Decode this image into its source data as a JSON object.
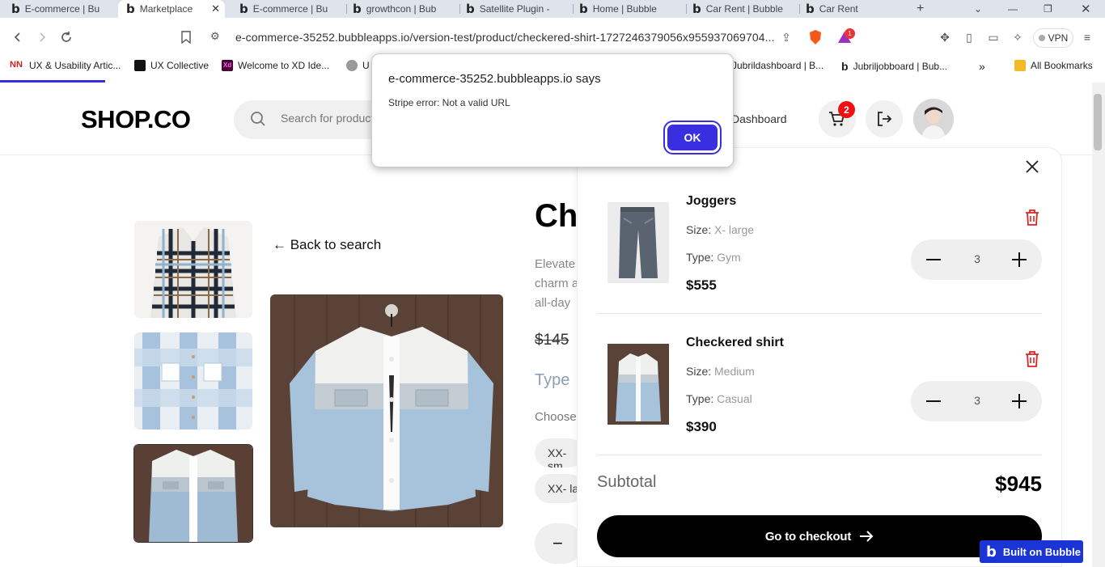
{
  "browser": {
    "tabs": [
      {
        "label": "E-commerce | Bu"
      },
      {
        "label": "Marketplace"
      },
      {
        "label": "E-commerce | Bu"
      },
      {
        "label": "growthcon | Bub"
      },
      {
        "label": "Satellite Plugin -"
      },
      {
        "label": "Home | Bubble"
      },
      {
        "label": "Car Rent | Bubble"
      },
      {
        "label": "Car Rent"
      }
    ],
    "new_tab": "+",
    "url": "e-commerce-35252.bubbleapps.io/version-test/product/checkered-shirt-1727246379056x955937069704...",
    "vpn_label": "VPN",
    "brave_rewards_count": "1",
    "bookmarks": [
      {
        "label": "UX & Usability Artic...",
        "color": "#c22"
      },
      {
        "label": "UX Collective",
        "color": "#111"
      },
      {
        "label": "Welcome to XD Ide...",
        "color": "#470137"
      },
      {
        "label": "U",
        "color": "#666"
      },
      {
        "label": "Jubrildashboard | B...",
        "color": "#222"
      },
      {
        "label": "Jubriljobboard | Bub...",
        "color": "#222"
      }
    ],
    "more_bookmarks": "»",
    "all_bookmarks": "All Bookmarks"
  },
  "header": {
    "logo": "SHOP.CO",
    "search_placeholder": "Search for products...",
    "dashboard_link": "Dashboard",
    "cart_count": "2"
  },
  "product": {
    "back_label": "← Back to search",
    "title": "Ch",
    "desc_lines": [
      "Elevate",
      "charm a",
      "all-day"
    ],
    "old_price": "$145",
    "type_label": "Type",
    "choose_label": "Choose",
    "size_chips": [
      "XX- sm",
      "XX- la"
    ],
    "qty_minus": "−"
  },
  "cart": {
    "items": [
      {
        "name": "Joggers",
        "size_label": "Size:",
        "size": "X- large",
        "type_label": "Type:",
        "type": "Gym",
        "price": "$555",
        "qty": "3"
      },
      {
        "name": "Checkered shirt",
        "size_label": "Size:",
        "size": "Medium",
        "type_label": "Type:",
        "type": "Casual",
        "price": "$390",
        "qty": "3"
      }
    ],
    "subtotal_label": "Subtotal",
    "subtotal_value": "$945",
    "checkout_label": "Go to checkout"
  },
  "dialog": {
    "title": "e-commerce-35252.bubbleapps.io says",
    "message": "Stripe error: Not a valid URL",
    "ok_label": "OK"
  },
  "bubble_badge": "Built on Bubble",
  "colors": {
    "accent": "#3a2fe0",
    "badge_red": "#e11111",
    "trash_red": "#e02424",
    "bubble_blue": "#1a34d6"
  }
}
